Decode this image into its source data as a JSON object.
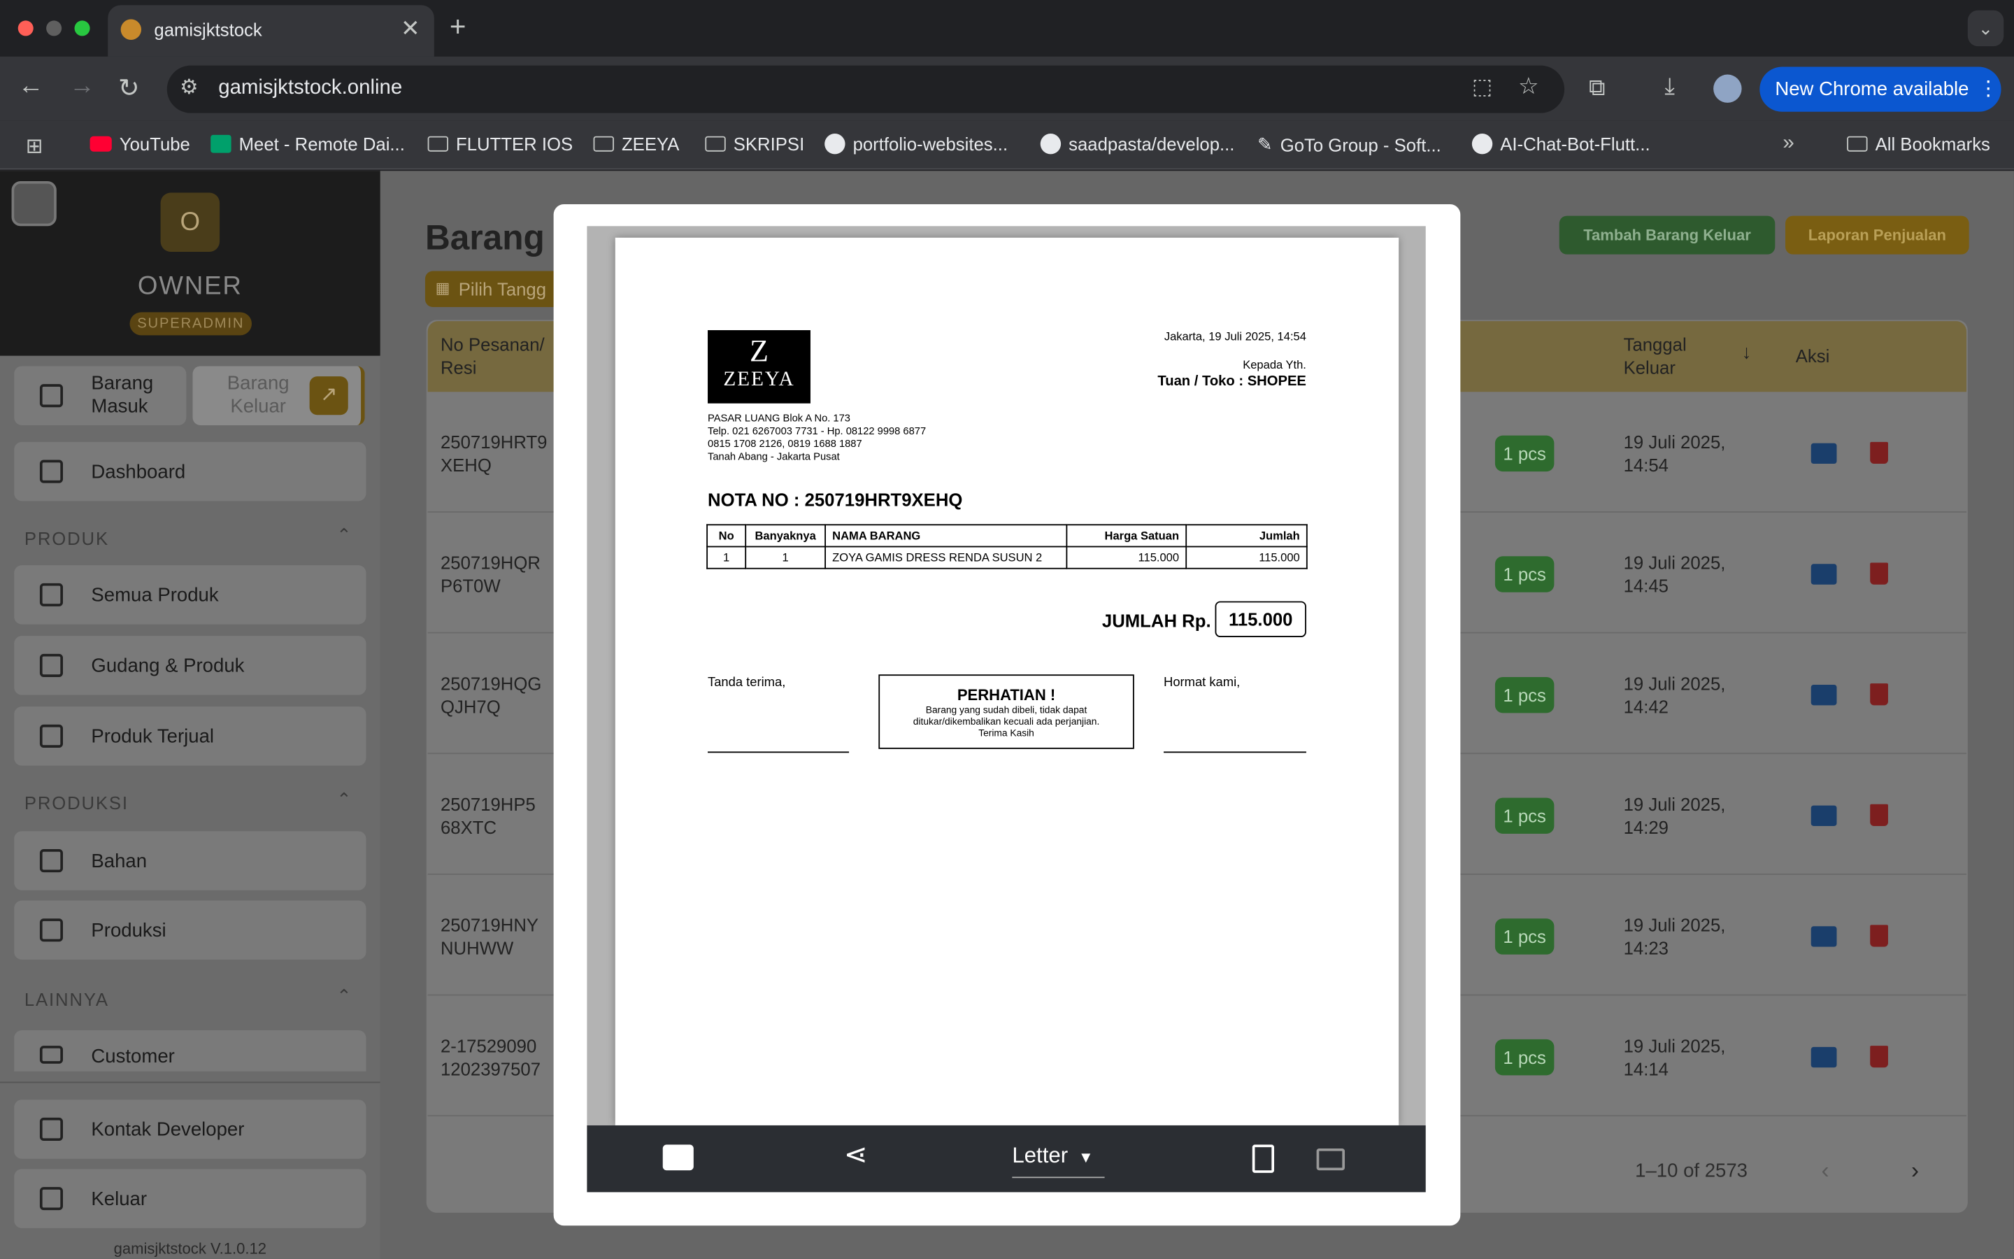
{
  "browser": {
    "tab_title": "gamisjktstock",
    "url": "gamisjktstock.online",
    "new_chrome": "New Chrome available",
    "bookmarks": [
      "YouTube",
      "Meet - Remote Dai...",
      "FLUTTER IOS",
      "ZEEYA",
      "SKRIPSI",
      "portfolio-websites...",
      "saadpasta/develop...",
      "GoTo Group - Soft...",
      "AI-Chat-Bot-Flutt..."
    ],
    "all_bookmarks": "All Bookmarks"
  },
  "sidebar": {
    "avatar_letter": "O",
    "user": "OWNER",
    "role": "SUPERADMIN",
    "barang_masuk": "Barang Masuk",
    "barang_keluar": "Barang Keluar",
    "dashboard": "Dashboard",
    "produk_header": "PRODUK",
    "semua_produk": "Semua Produk",
    "gudang": "Gudang & Produk",
    "produk_terjual": "Produk Terjual",
    "produksi_header": "PRODUKSI",
    "bahan": "Bahan",
    "produksi": "Produksi",
    "lainnya_header": "LAINNYA",
    "customer": "Customer",
    "kontak": "Kontak Developer",
    "keluar": "Keluar",
    "version": "gamisjktstock V.1.0.12"
  },
  "main": {
    "title": "Barang",
    "date_filter": "Pilih Tangg",
    "btn_tambah": "Tambah Barang Keluar",
    "btn_laporan": "Laporan Penjualan",
    "col_no": "No Pesanan/ Resi",
    "col_tanggal": "Tanggal Keluar",
    "col_aksi": "Aksi",
    "rows": [
      {
        "no": "250719HRT9 XEHQ",
        "qty": "1 pcs",
        "date": "19 Juli 2025, 14:54"
      },
      {
        "no": "250719HQR P6T0W",
        "qty": "1 pcs",
        "date": "19 Juli 2025, 14:45"
      },
      {
        "no": "250719HQG QJH7Q",
        "qty": "1 pcs",
        "date": "19 Juli 2025, 14:42"
      },
      {
        "no": "250719HP5 68XTC",
        "qty": "1 pcs",
        "date": "19 Juli 2025, 14:29"
      },
      {
        "no": "250719HNY NUHWW",
        "qty": "1 pcs",
        "date": "19 Juli 2025, 14:23"
      },
      {
        "no": "2-17529090 1202397507",
        "qty": "1 pcs",
        "date": "19 Juli 2025, 14:14"
      }
    ],
    "pagination": "1–10 of 2573"
  },
  "invoice": {
    "logo_letter": "Z",
    "logo_name": "ZEEYA",
    "address": [
      "PASAR LUANG Blok A No. 173",
      "Telp. 021 6267003 7731 - Hp. 08122 9998 6877",
      "0815 1708 2126, 0819 1688 1887",
      "Tanah Abang - Jakarta Pusat"
    ],
    "date": "Jakarta, 19 Juli 2025, 14:54",
    "kepada": "Kepada Yth.",
    "tujuan": "Tuan / Toko : SHOPEE",
    "nota": "NOTA NO : 250719HRT9XEHQ",
    "headers": [
      "No",
      "Banyaknya",
      "NAMA BARANG",
      "Harga Satuan",
      "Jumlah"
    ],
    "item": [
      "1",
      "1",
      "ZOYA GAMIS DRESS RENDA SUSUN 2",
      "115.000",
      "115.000"
    ],
    "jumlah_label": "JUMLAH Rp.",
    "jumlah_value": "115.000",
    "tanda_terima": "Tanda terima,",
    "perhatian_title": "PERHATIAN !",
    "perhatian_text": "Barang yang sudah dibeli, tidak dapat ditukar/dikembalikan kecuali ada perjanjian. Terima Kasih",
    "hormat": "Hormat kami,"
  },
  "viewer": {
    "paper_size": "Letter"
  }
}
